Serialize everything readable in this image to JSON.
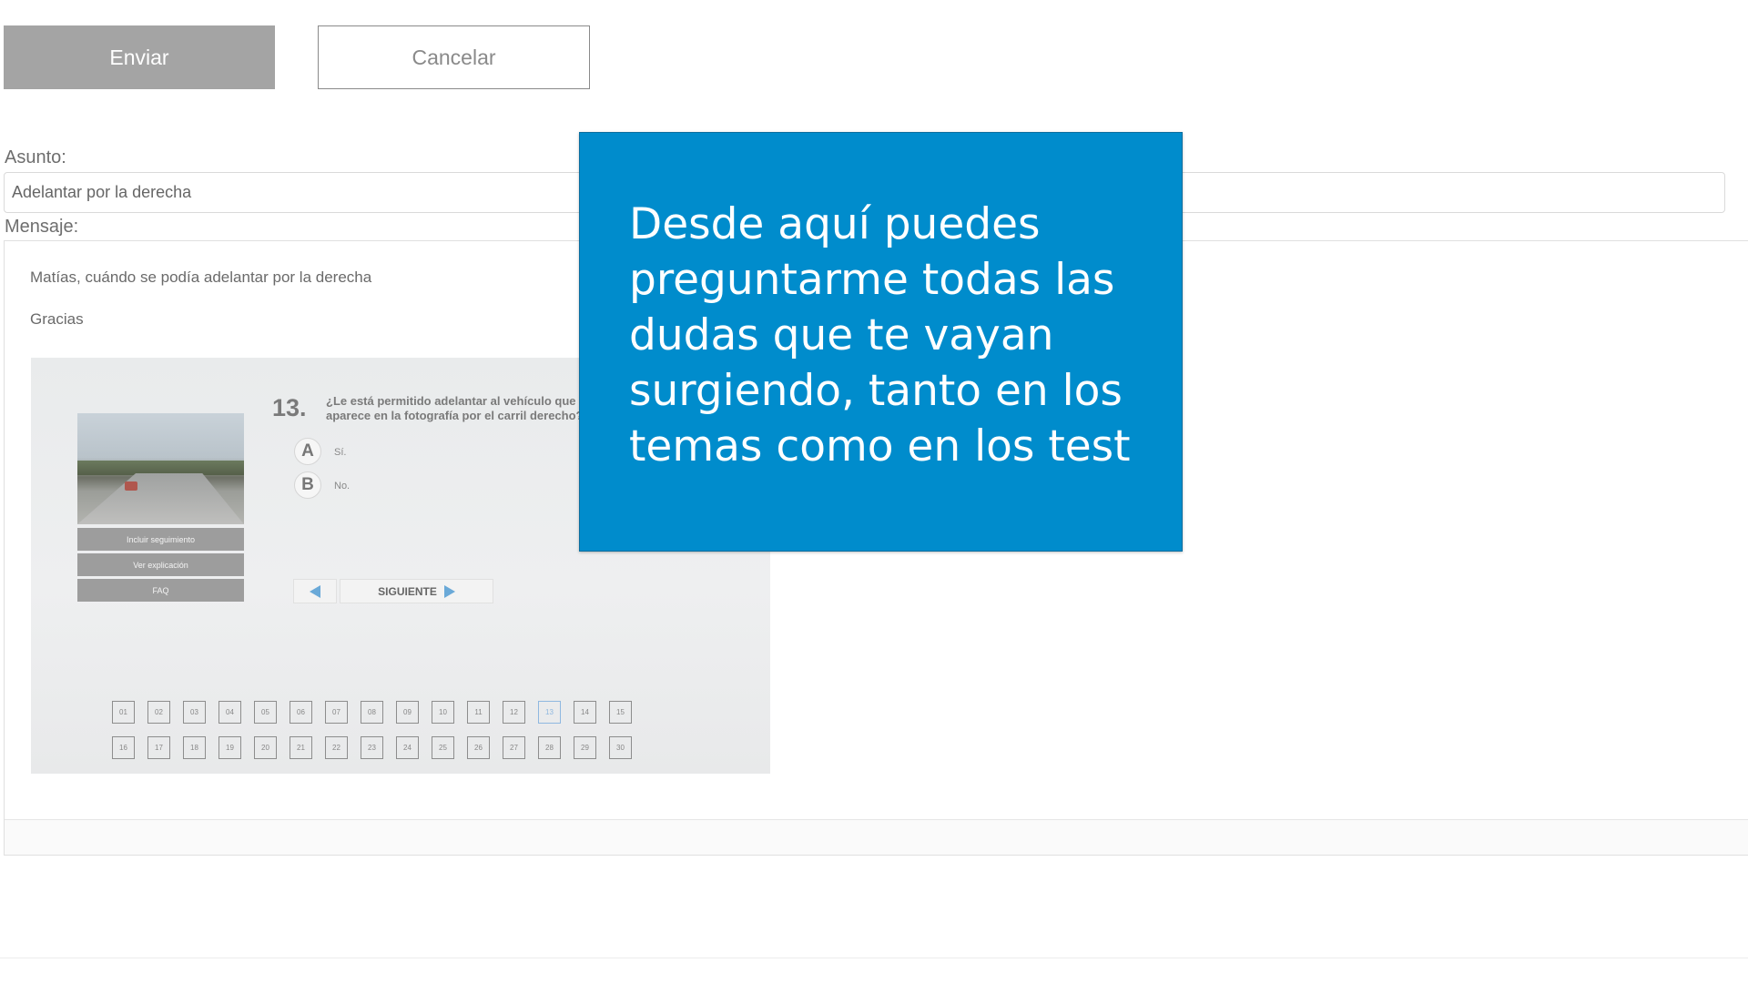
{
  "actions": {
    "send_label": "Enviar",
    "cancel_label": "Cancelar"
  },
  "form": {
    "subject_label": "Asunto:",
    "subject_value": "Adelantar por la derecha",
    "message_label": "Mensaje:",
    "message_lines": [
      "Matías, cuándo se podía adelantar por la derecha",
      "Gracias"
    ]
  },
  "embedded_test": {
    "question_number": "13.",
    "question_text": "¿Le está permitido adelantar al vehículo que aparece en la fotografía por el carril derecho?",
    "options": [
      {
        "letter": "A",
        "text": "Sí."
      },
      {
        "letter": "B",
        "text": "No."
      }
    ],
    "side_buttons": [
      "Incluir seguimiento",
      "Ver explicación",
      "FAQ"
    ],
    "next_label": "SIGUIENTE",
    "question_grid": [
      [
        "01",
        "02",
        "03",
        "04",
        "05",
        "06",
        "07",
        "08",
        "09",
        "10",
        "11",
        "12",
        "13",
        "14",
        "15"
      ],
      [
        "16",
        "17",
        "18",
        "19",
        "20",
        "21",
        "22",
        "23",
        "24",
        "25",
        "26",
        "27",
        "28",
        "29",
        "30"
      ]
    ],
    "current_question": "13"
  },
  "tooltip": {
    "text": "Desde aquí puedes preguntarme todas las dudas que te vayan surgiendo, tanto en los temas como en los test",
    "color": "#008ccc"
  }
}
